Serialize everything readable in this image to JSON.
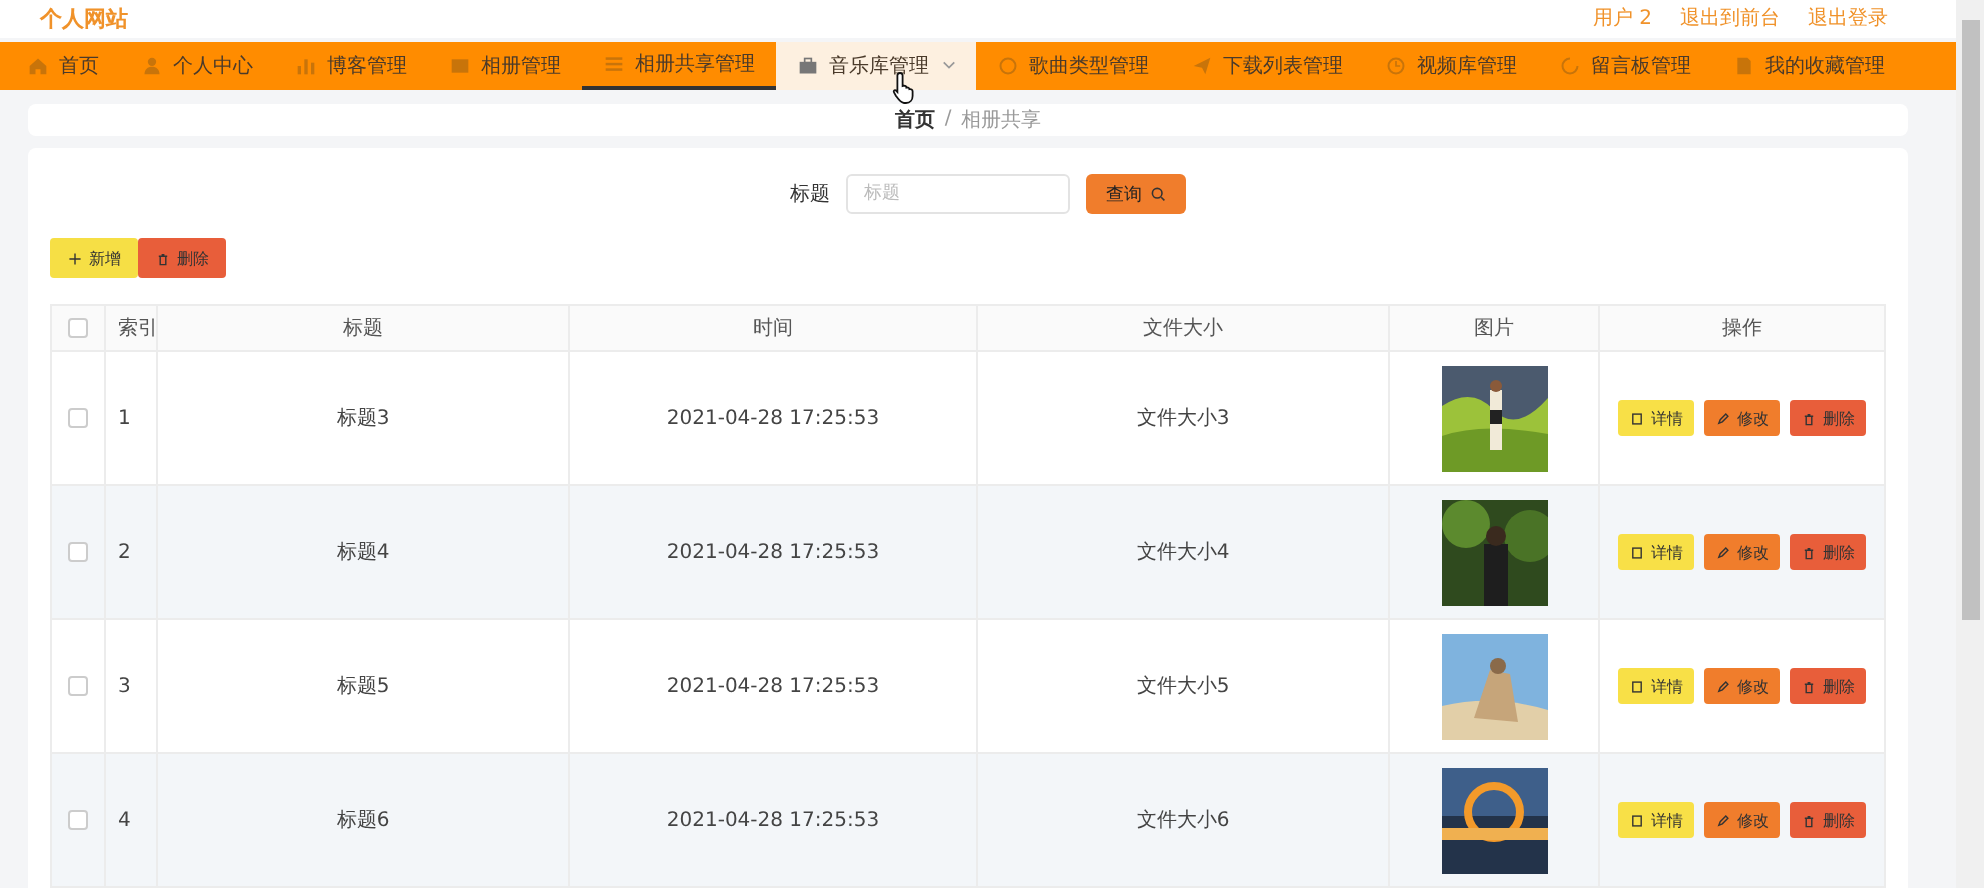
{
  "header": {
    "title": "个人网站",
    "links": [
      "用户 2",
      "退出到前台",
      "退出登录"
    ]
  },
  "nav": [
    {
      "label": "首页",
      "selected": false,
      "highlighted": false,
      "has_menu": false
    },
    {
      "label": "个人中心",
      "selected": false,
      "highlighted": false,
      "has_menu": false
    },
    {
      "label": "博客管理",
      "selected": false,
      "highlighted": false,
      "has_menu": false
    },
    {
      "label": "相册管理",
      "selected": false,
      "highlighted": false,
      "has_menu": false
    },
    {
      "label": "相册共享管理",
      "selected": true,
      "highlighted": false,
      "has_menu": false
    },
    {
      "label": "音乐库管理",
      "selected": false,
      "highlighted": true,
      "has_menu": true
    },
    {
      "label": "歌曲类型管理",
      "selected": false,
      "highlighted": false,
      "has_menu": false
    },
    {
      "label": "下载列表管理",
      "selected": false,
      "highlighted": false,
      "has_menu": false
    },
    {
      "label": "视频库管理",
      "selected": false,
      "highlighted": false,
      "has_menu": false
    },
    {
      "label": "留言板管理",
      "selected": false,
      "highlighted": false,
      "has_menu": false
    },
    {
      "label": "我的收藏管理",
      "selected": false,
      "highlighted": false,
      "has_menu": false
    }
  ],
  "breadcrumb": {
    "items": [
      "首页",
      "相册共享"
    ],
    "separator": "/"
  },
  "search": {
    "label": "标题",
    "placeholder": "标题",
    "button": "查询"
  },
  "toolbar": [
    {
      "label": "新增",
      "kind": "add"
    },
    {
      "label": "删除",
      "kind": "delete"
    }
  ],
  "table": {
    "header_checked": false,
    "columns": [
      "索引",
      "标题",
      "时间",
      "文件大小",
      "图片",
      "操作"
    ],
    "rows": [
      {
        "checked": false,
        "index": "1",
        "title": "标题3",
        "time": "2021-04-28 17:25:53",
        "size": "文件大小3",
        "actions": [
          {
            "label": "详情",
            "kind": "detail"
          },
          {
            "label": "修改",
            "kind": "edit"
          },
          {
            "label": "删除",
            "kind": "delete"
          }
        ]
      },
      {
        "checked": false,
        "index": "2",
        "title": "标题4",
        "time": "2021-04-28 17:25:53",
        "size": "文件大小4",
        "actions": [
          {
            "label": "详情",
            "kind": "detail"
          },
          {
            "label": "修改",
            "kind": "edit"
          },
          {
            "label": "删除",
            "kind": "delete"
          }
        ]
      },
      {
        "checked": false,
        "index": "3",
        "title": "标题5",
        "time": "2021-04-28 17:25:53",
        "size": "文件大小5",
        "actions": [
          {
            "label": "详情",
            "kind": "detail"
          },
          {
            "label": "修改",
            "kind": "edit"
          },
          {
            "label": "删除",
            "kind": "delete"
          }
        ]
      },
      {
        "checked": false,
        "index": "4",
        "title": "标题6",
        "time": "2021-04-28 17:25:53",
        "size": "文件大小6",
        "actions": [
          {
            "label": "详情",
            "kind": "detail"
          },
          {
            "label": "修改",
            "kind": "edit"
          },
          {
            "label": "删除",
            "kind": "delete"
          }
        ]
      }
    ]
  }
}
